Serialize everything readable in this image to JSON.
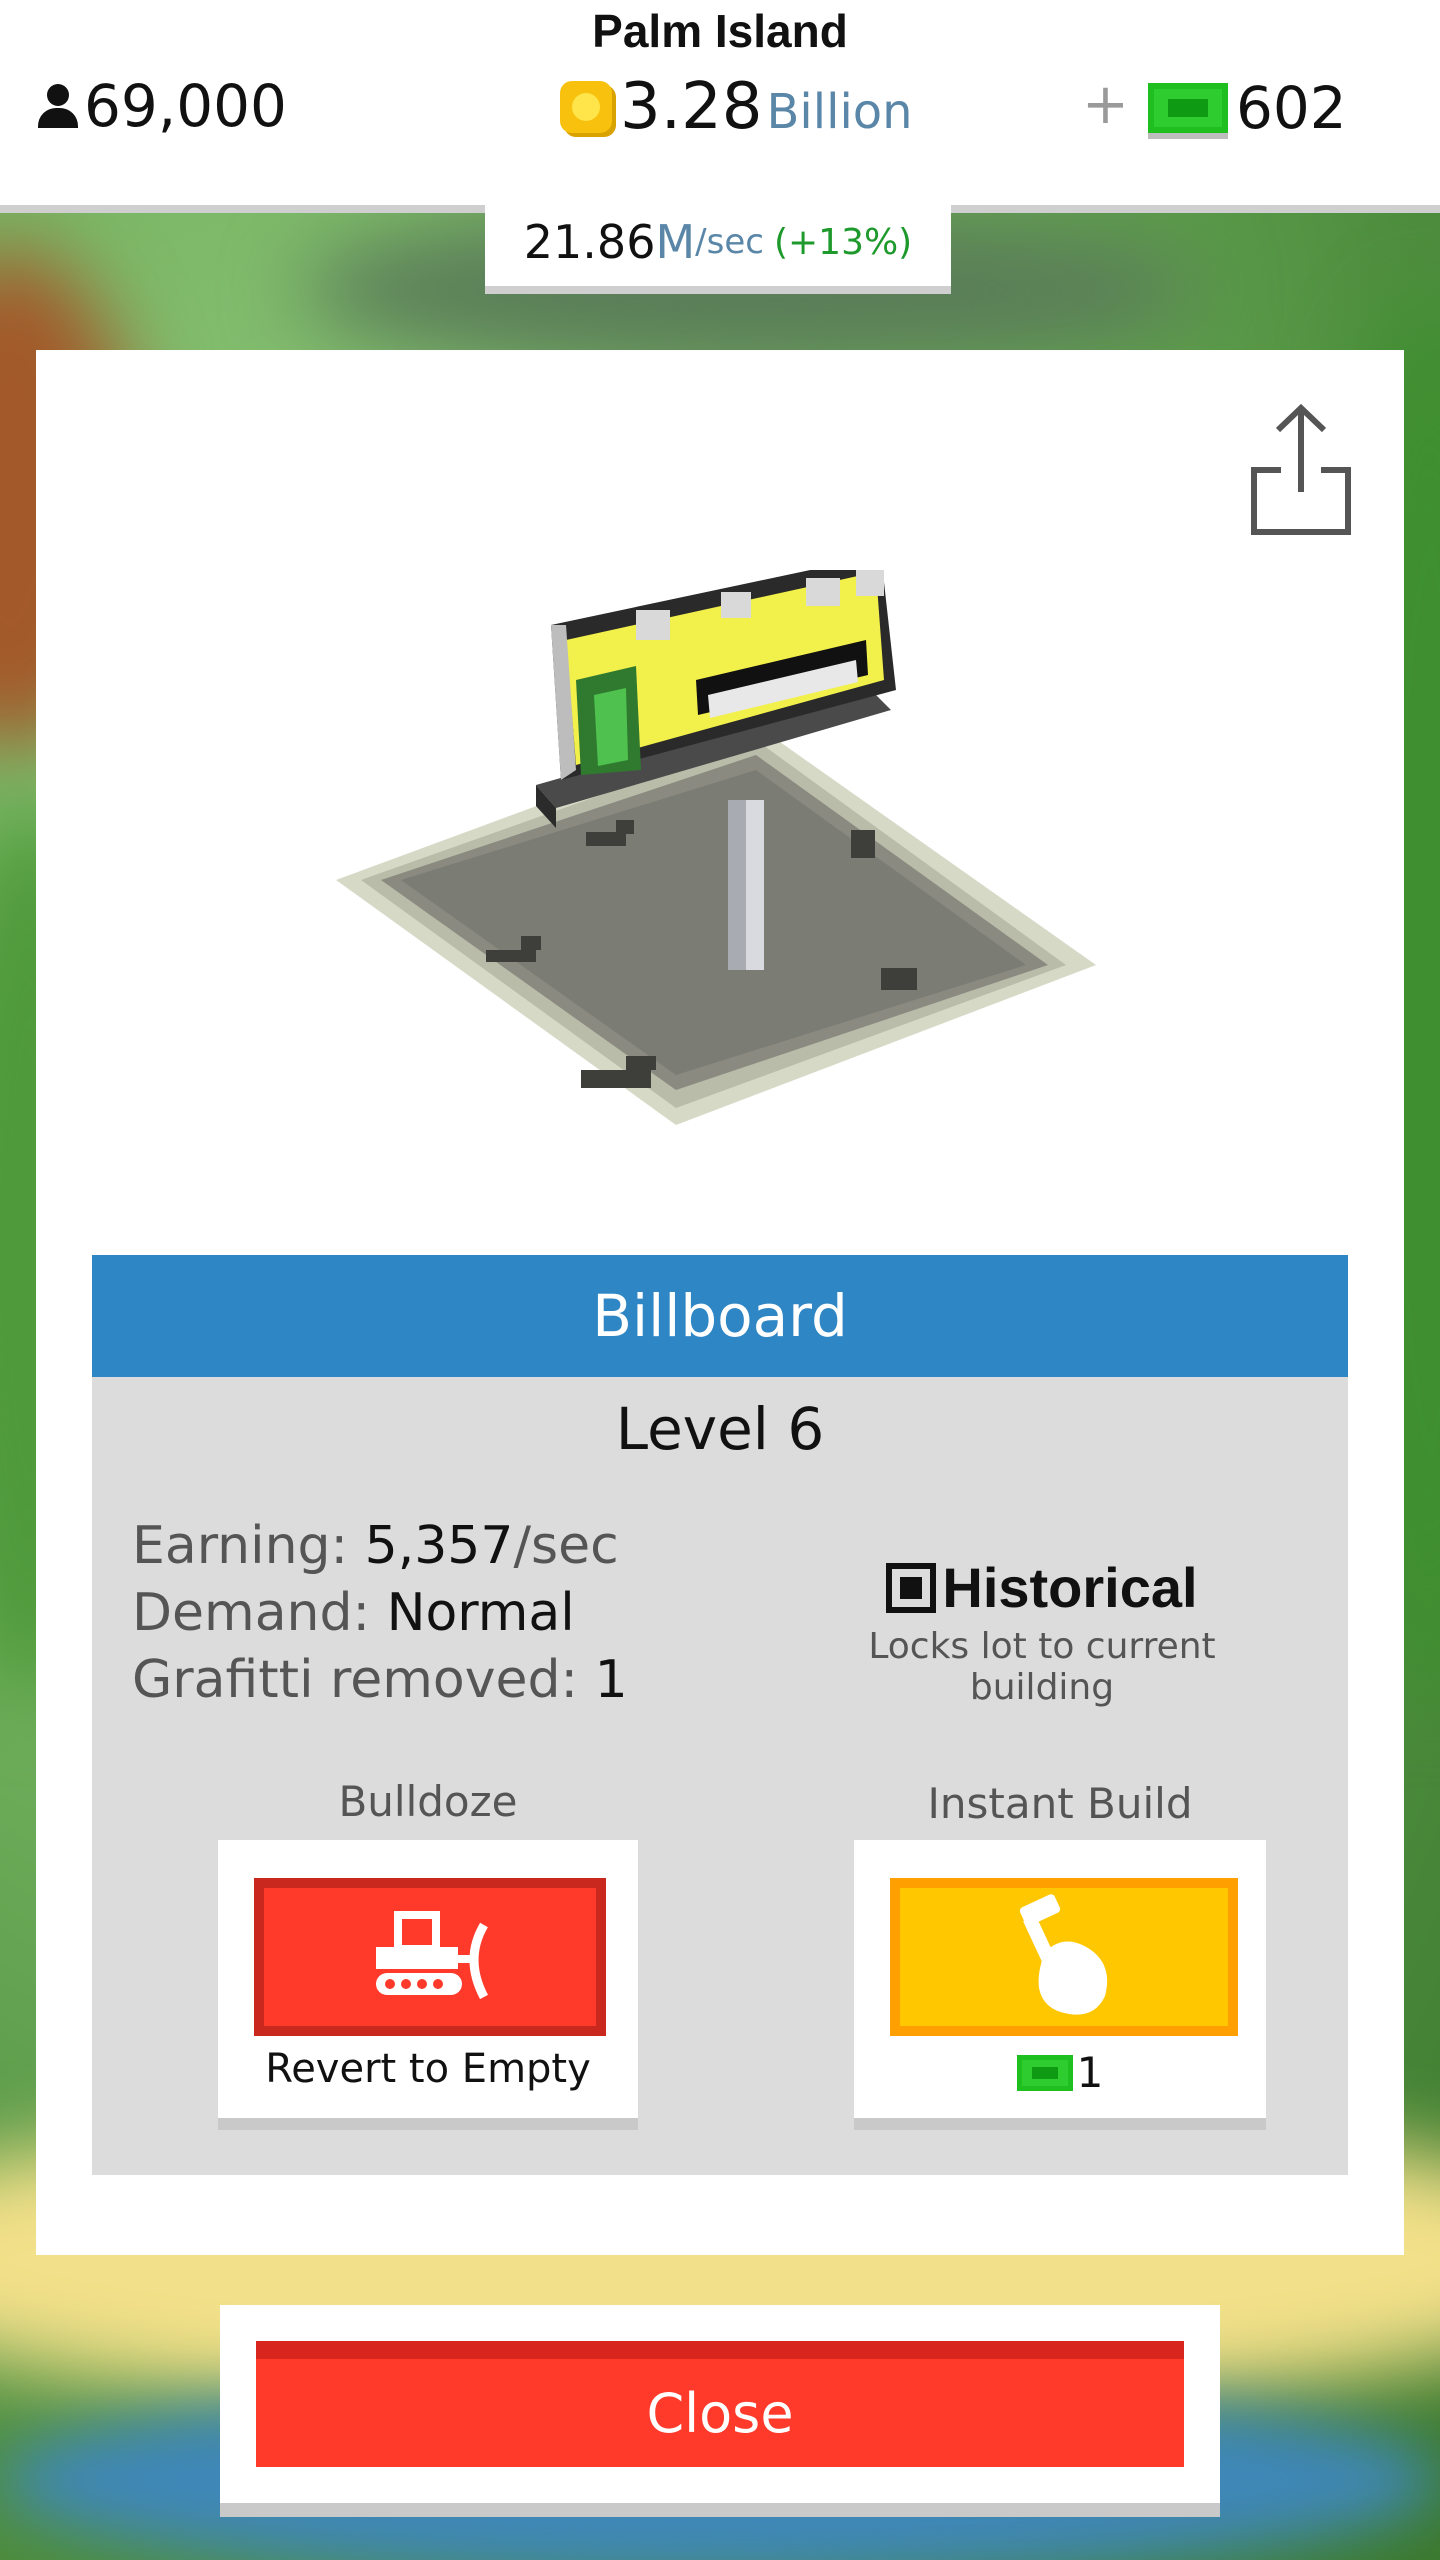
{
  "header": {
    "island_name": "Palm Island",
    "population": "69,000",
    "money_value": "3.28",
    "money_unit": "Billion",
    "plus": "+",
    "cash": "602",
    "rate_value": "21.86",
    "rate_unit": "M",
    "rate_per": "/sec",
    "rate_bonus": "(+13%)"
  },
  "building": {
    "name": "Billboard",
    "level": "Level 6",
    "earning_label": "Earning:",
    "earning_value": "5,357",
    "earning_unit": "/sec",
    "demand_label": "Demand:",
    "demand_value": "Normal",
    "graffiti_label": "Grafitti removed:",
    "graffiti_value": "1"
  },
  "historical": {
    "label": "Historical",
    "description": "Locks lot to current building",
    "checked": true
  },
  "actions": {
    "bulldoze_label": "Bulldoze",
    "bulldoze_caption": "Revert to Empty",
    "instant_label": "Instant Build",
    "instant_cost": "1"
  },
  "footer": {
    "close_label": "Close"
  },
  "colors": {
    "title_bar": "#2e86c4",
    "bulldoze": "#ff3a2a",
    "instant": "#ffc700",
    "cash_green": "#2ecc2e",
    "bonus_green": "#1e9a2c"
  },
  "icons": {
    "population": "person-icon",
    "money": "coin-icon",
    "cash": "cash-icon",
    "share": "share-icon",
    "bulldoze": "bulldozer-icon",
    "instant": "hammer-hand-icon"
  }
}
